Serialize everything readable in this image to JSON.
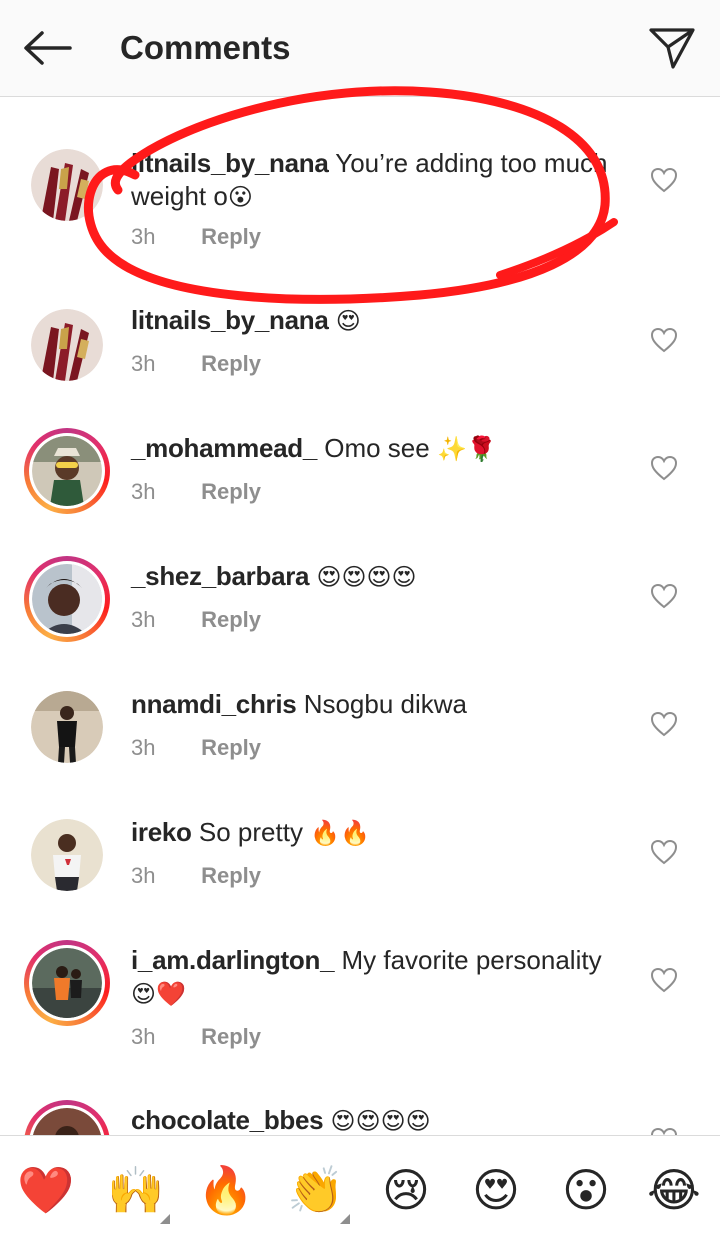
{
  "header": {
    "title": "Comments"
  },
  "comments": [
    {
      "username": "litnails_by_nana",
      "text": "You’re adding too much weight o",
      "emoji": "😮",
      "time": "3h",
      "reply": "Reply"
    },
    {
      "username": "litnails_by_nana",
      "text": "",
      "emoji": "😍",
      "time": "3h",
      "reply": "Reply"
    },
    {
      "username": "_mohammead_",
      "text": "Omo see",
      "emoji": "✨🌹",
      "time": "3h",
      "reply": "Reply"
    },
    {
      "username": "_shez_barbara",
      "text": "",
      "emoji": "😍😍😍😍",
      "time": "3h",
      "reply": "Reply"
    },
    {
      "username": "nnamdi_chris",
      "text": "Nsogbu dikwa",
      "emoji": "",
      "time": "3h",
      "reply": "Reply"
    },
    {
      "username": "ireko",
      "text": "So pretty",
      "emoji": "🔥🔥",
      "time": "3h",
      "reply": "Reply"
    },
    {
      "username": "i_am.darlington_",
      "text": "My favorite personality",
      "emoji": "😍❤️",
      "time": "3h",
      "reply": "Reply"
    },
    {
      "username": "chocolate_bbes",
      "text": "",
      "emoji": "😍😍😍😍",
      "time": "",
      "reply": ""
    }
  ],
  "emoji_bar": [
    "❤️",
    "🙌",
    "🔥",
    "👏",
    "😢",
    "😍",
    "😮",
    "😂"
  ],
  "colors": {
    "annotation": "#ff1a1a",
    "story_ring": "#e1306c",
    "secondary_text": "#8e8e8e"
  },
  "icons": {
    "back": "arrow-left-icon",
    "send": "paper-plane-icon",
    "like": "heart-outline-icon"
  }
}
